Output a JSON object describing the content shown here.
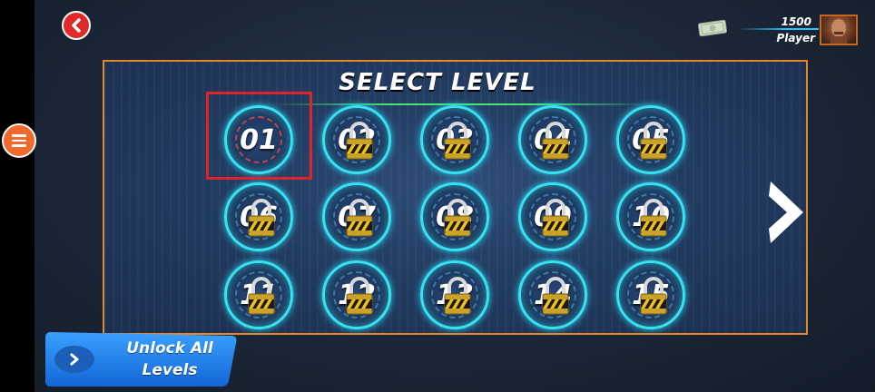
{
  "header": {
    "money": "1500",
    "player_name": "Player",
    "icons": [
      "back-icon",
      "cash-icon",
      "avatar",
      "menu-icon"
    ]
  },
  "panel": {
    "title": "SELECT LEVEL",
    "levels": [
      {
        "label": "01",
        "locked": false
      },
      {
        "label": "02",
        "locked": true
      },
      {
        "label": "03",
        "locked": true
      },
      {
        "label": "04",
        "locked": true
      },
      {
        "label": "05",
        "locked": true
      },
      {
        "label": "06",
        "locked": true
      },
      {
        "label": "07",
        "locked": true
      },
      {
        "label": "08",
        "locked": true
      },
      {
        "label": "09",
        "locked": true
      },
      {
        "label": "10",
        "locked": true
      },
      {
        "label": "11",
        "locked": true
      },
      {
        "label": "12",
        "locked": true
      },
      {
        "label": "13",
        "locked": true
      },
      {
        "label": "14",
        "locked": true
      },
      {
        "label": "15",
        "locked": true
      }
    ]
  },
  "unlock_all": {
    "line1": "Unlock All",
    "line2": "Levels"
  },
  "colors": {
    "panel_border": "#e8852a",
    "ring": "#38e1f2",
    "back_button": "#e02a2a",
    "menu_button": "#f06a2e",
    "highlight": "#e0232a",
    "unlock_button": "#1e7be6"
  }
}
